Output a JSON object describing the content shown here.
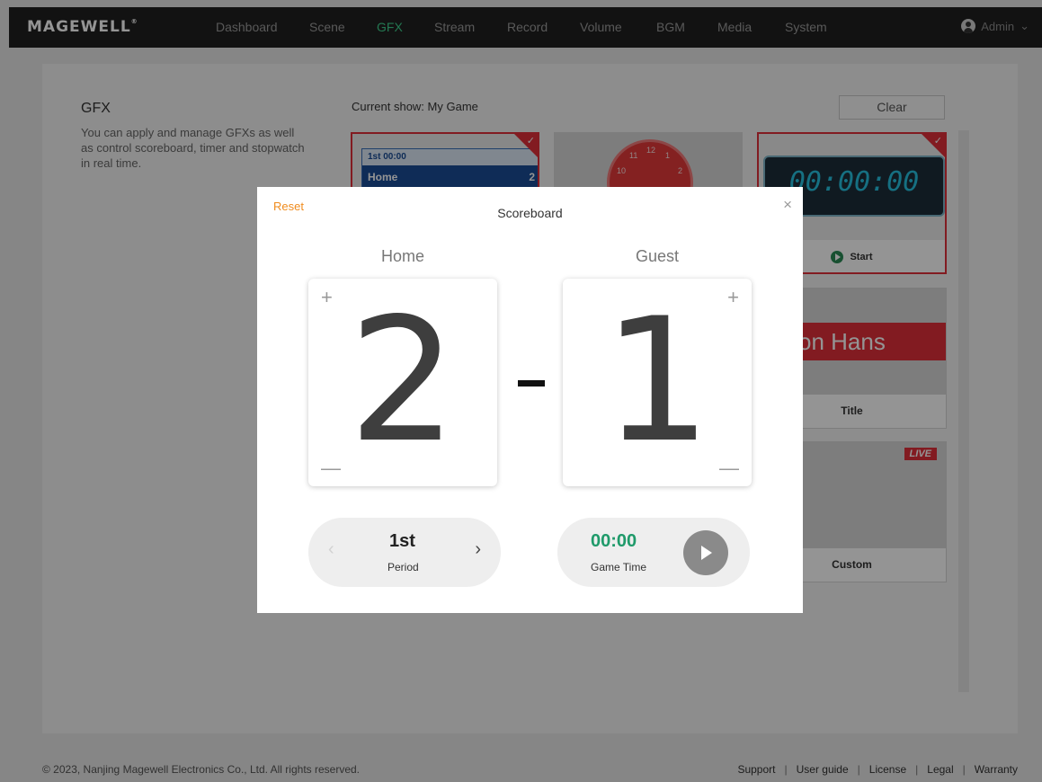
{
  "header": {
    "logo": "MAGEWELL",
    "nav": [
      "Dashboard",
      "Scene",
      "GFX",
      "Stream",
      "Record",
      "Volume",
      "BGM",
      "Media",
      "System"
    ],
    "active_nav": "GFX",
    "user": "Admin"
  },
  "page": {
    "title": "GFX",
    "description": "You can apply and manage GFXs as well as control scoreboard, timer and stopwatch in real time.",
    "current_show": "Current show: My Game",
    "clear_label": "Clear"
  },
  "cards": {
    "scoreboard_thumb": {
      "period_time": "1st  00:00",
      "team": "Home",
      "score": "2"
    },
    "clock_thumb": {
      "numbers": [
        "12",
        "1",
        "2",
        "11",
        "10"
      ]
    },
    "timer": {
      "digits": "00:00:00",
      "action": "Start"
    },
    "title": {
      "text": "son Hans",
      "label": "Title"
    },
    "custom": {
      "badge": "LIVE",
      "label": "Custom"
    }
  },
  "modal": {
    "reset": "Reset",
    "title": "Scoreboard",
    "close": "×",
    "home": {
      "label": "Home",
      "score": "2"
    },
    "guest": {
      "label": "Guest",
      "score": "1"
    },
    "plus": "+",
    "minus": "—",
    "period": {
      "value": "1st",
      "label": "Period"
    },
    "game_time": {
      "value": "00:00",
      "label": "Game Time"
    },
    "prev": "‹",
    "next": "›"
  },
  "footer": {
    "copyright": "© 2023, Nanjing Magewell Electronics Co., Ltd. All rights reserved.",
    "links": [
      "Support",
      "User guide",
      "License",
      "Legal",
      "Warranty"
    ]
  }
}
